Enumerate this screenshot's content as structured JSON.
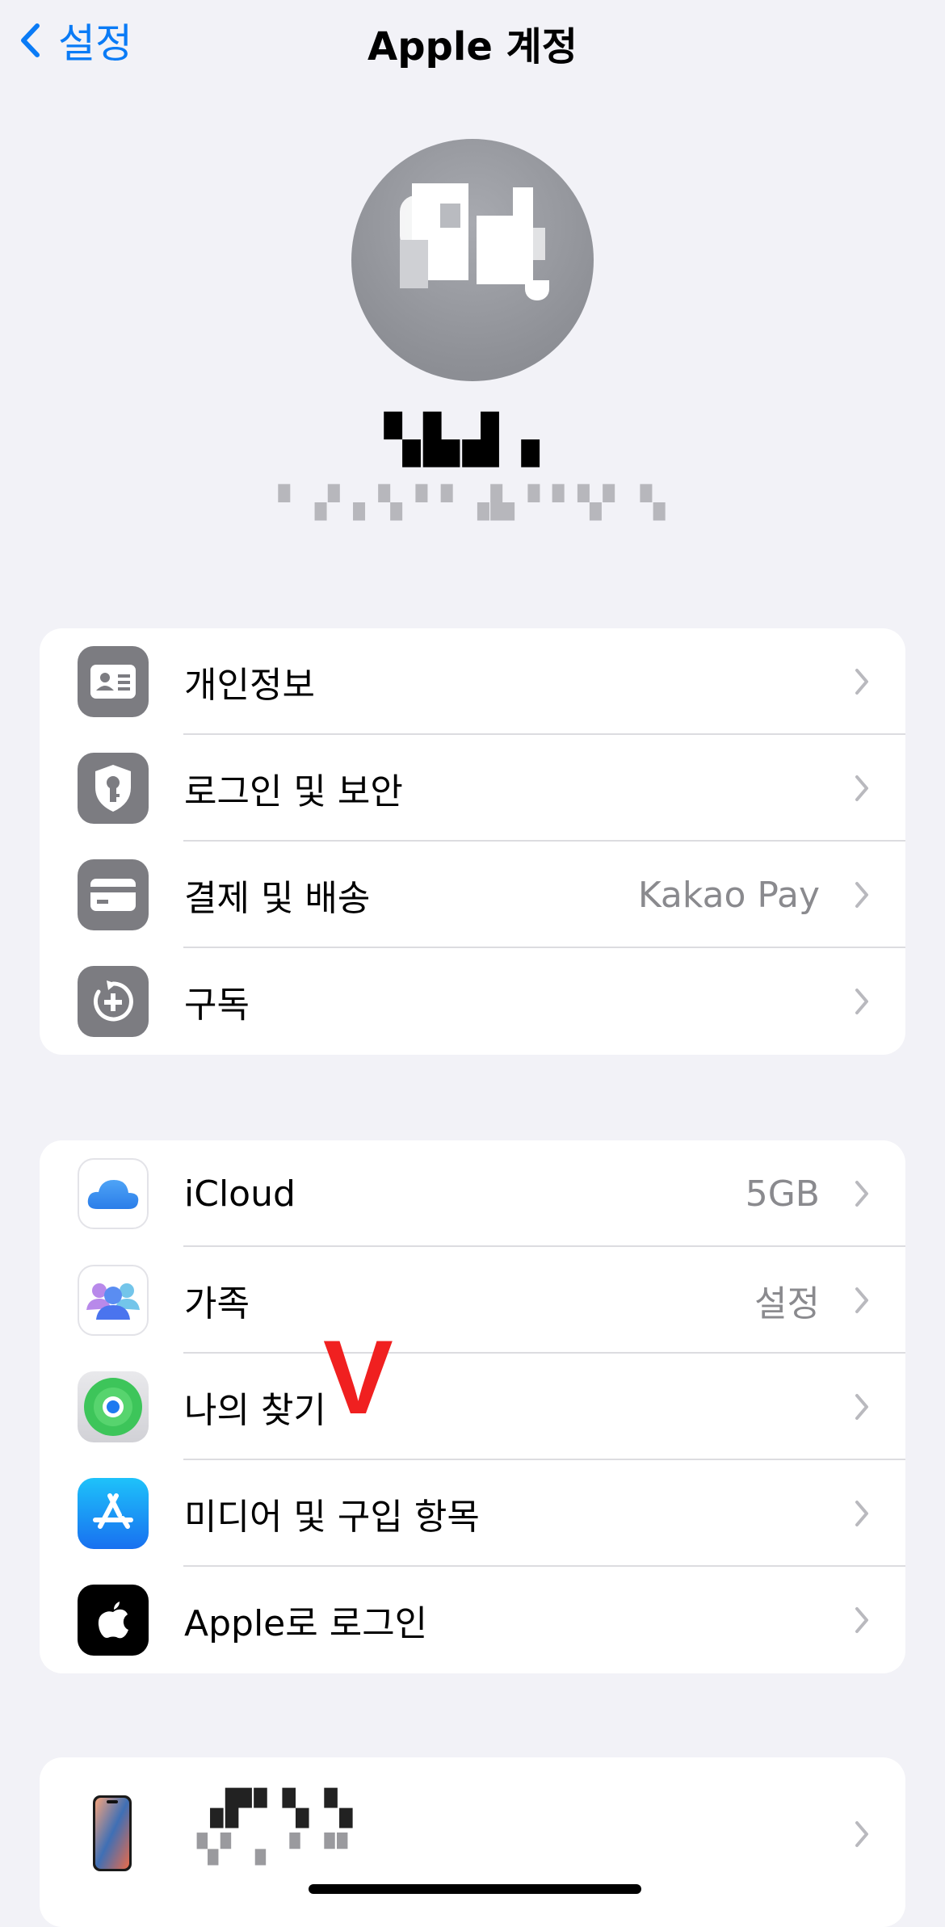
{
  "nav": {
    "back_label": "설정",
    "title": "Apple 계정"
  },
  "profile": {
    "name": "▚▙▟ ▖",
    "email": "▝ ▗▘▖▚▝▝ ▗▙▝ ▘▚▘▝▖"
  },
  "account_group": [
    {
      "label": "개인정보",
      "value": "",
      "icon": "id-card-icon"
    },
    {
      "label": "로그인 및 보안",
      "value": "",
      "icon": "shield-key-icon"
    },
    {
      "label": "결제 및 배송",
      "value": "Kakao Pay",
      "icon": "credit-card-icon"
    },
    {
      "label": "구독",
      "value": "",
      "icon": "subscription-icon"
    }
  ],
  "services_group": [
    {
      "label": "iCloud",
      "value": "5GB",
      "icon": "icloud-icon"
    },
    {
      "label": "가족",
      "value": "설정",
      "icon": "family-icon"
    },
    {
      "label": "나의 찾기",
      "value": "",
      "icon": "find-my-icon"
    },
    {
      "label": "미디어 및 구입 항목",
      "value": "",
      "icon": "app-store-icon"
    },
    {
      "label": "Apple로 로그인",
      "value": "",
      "icon": "apple-logo-icon"
    }
  ],
  "annotation_mark": "V",
  "device": {
    "name": "▗▛▘▚▝▖",
    "subtitle": "▚▘ ▖▝ ▝▘",
    "icon": "iphone-icon"
  },
  "colors": {
    "accent": "#0a7bf6",
    "background": "#f2f2f7",
    "annotation": "#f02020"
  }
}
